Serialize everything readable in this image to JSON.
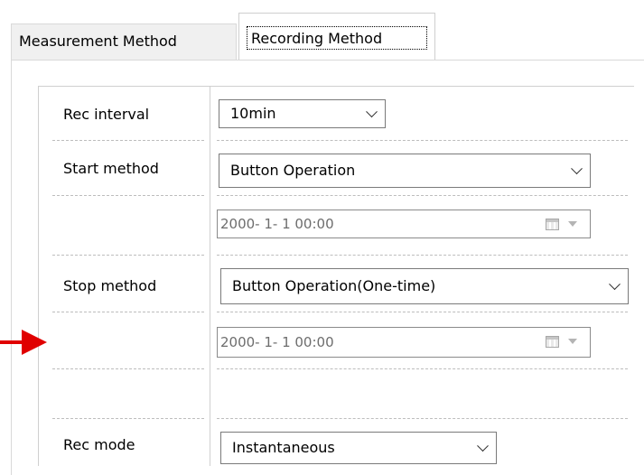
{
  "tabs": [
    {
      "label": "Measurement Method",
      "active": false
    },
    {
      "label": "Recording Method",
      "active": true
    }
  ],
  "form": {
    "rec_interval": {
      "label": "Rec interval",
      "value": "10min"
    },
    "start_method": {
      "label": "Start method",
      "value": "Button Operation",
      "datetime": "2000-  1-  1 00:00"
    },
    "stop_method": {
      "label": "Stop method",
      "value": "Button Operation(One-time)",
      "datetime": "2000-  1-  1 00:00"
    },
    "rec_mode": {
      "label": "Rec mode",
      "value": "Instantaneous"
    }
  },
  "icons": {
    "dropdown": "chevron-down-icon",
    "calendar": "calendar-icon",
    "annotation_arrow": "arrow-right-icon"
  },
  "colors": {
    "annotation_arrow": "#e00000",
    "active_tab": "#ffffff",
    "inactive_tab": "#f0f0f0"
  }
}
